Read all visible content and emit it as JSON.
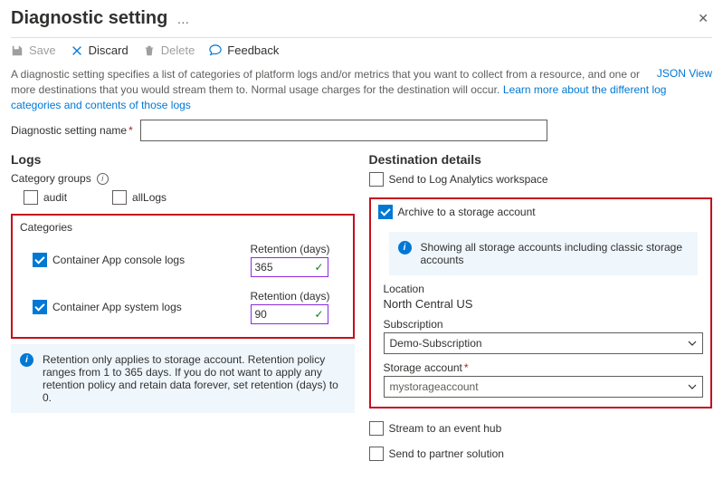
{
  "header": {
    "title": "Diagnostic setting",
    "more": "…"
  },
  "toolbar": {
    "save": "Save",
    "discard": "Discard",
    "delete": "Delete",
    "feedback": "Feedback"
  },
  "description": "A diagnostic setting specifies a list of categories of platform logs and/or metrics that you want to collect from a resource, and one or more destinations that you would stream them to. Normal usage charges for the destination will occur.",
  "learn_link": "Learn more about the different log categories and contents of those logs",
  "json_view": "JSON View",
  "name_label": "Diagnostic setting name",
  "name_value": "",
  "logs": {
    "title": "Logs",
    "group_label": "Category groups",
    "group_audit": "audit",
    "group_all": "allLogs",
    "cat_label": "Categories",
    "cat1": "Container App console logs",
    "cat2": "Container App system logs",
    "ret_label": "Retention (days)",
    "ret1": "365",
    "ret2": "90",
    "info": "Retention only applies to storage account. Retention policy ranges from 1 to 365 days. If you do not want to apply any retention policy and retain data forever, set retention (days) to 0."
  },
  "dest": {
    "title": "Destination details",
    "law": "Send to Log Analytics workspace",
    "archive": "Archive to a storage account",
    "info": "Showing all storage accounts including classic storage accounts",
    "loc_label": "Location",
    "loc_value": "North Central US",
    "sub_label": "Subscription",
    "sub_value": "Demo-Subscription",
    "stor_label": "Storage account",
    "stor_value": "mystorageaccount",
    "evh": "Stream to an event hub",
    "partner": "Send to partner solution"
  }
}
